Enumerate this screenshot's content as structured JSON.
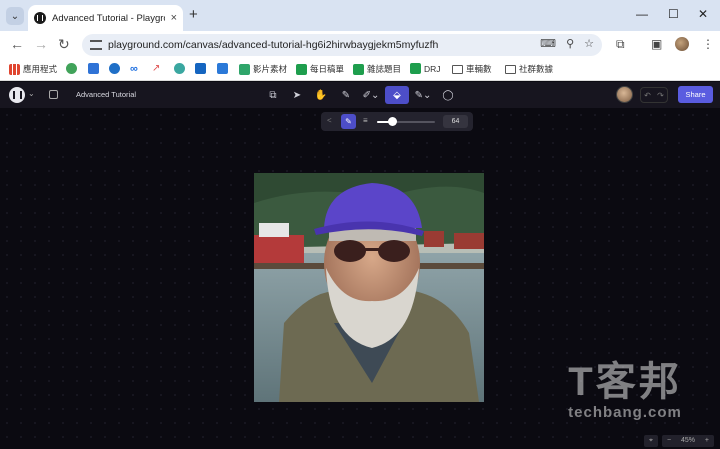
{
  "browser": {
    "tab": {
      "title": "Advanced Tutorial - Playground"
    },
    "url": "playground.com/canvas/advanced-tutorial-hg6i2hirwbaygjekm5myfuzfh",
    "bookmarks": [
      {
        "label": "應用程式",
        "icon": "apps-grid-icon"
      },
      {
        "label": "",
        "icon": "puzzle-icon"
      },
      {
        "label": "",
        "icon": "drive-icon"
      },
      {
        "label": "",
        "icon": "c-icon"
      },
      {
        "label": "",
        "icon": "meta-icon"
      },
      {
        "label": "",
        "icon": "trend-icon"
      },
      {
        "label": "",
        "icon": "circle-icon"
      },
      {
        "label": "",
        "icon": "outlook-icon"
      },
      {
        "label": "",
        "icon": "calendar-icon"
      },
      {
        "label": "影片素材",
        "icon": "green-sheet-icon"
      },
      {
        "label": "每日稿單",
        "icon": "green-plus-icon"
      },
      {
        "label": "雜誌題目",
        "icon": "green-plus-icon"
      },
      {
        "label": "DRJ",
        "icon": "green-plus-icon"
      },
      {
        "label": "車輛數",
        "icon": "folder-icon"
      },
      {
        "label": "社群數據",
        "icon": "folder-icon"
      }
    ]
  },
  "app": {
    "title": "Advanced Tutorial",
    "share_label": "Share",
    "tools": [
      "canvas-icon",
      "pointer-icon",
      "hand-icon",
      "edit-image-icon",
      "draw-icon",
      "paint-bucket-icon",
      "pen-icon",
      "comment-icon"
    ],
    "active_tool": "paint-bucket-icon"
  },
  "brush": {
    "size": "64",
    "slider_fraction": 0.25
  },
  "zoom": {
    "minus": "−",
    "level": "45%",
    "plus": "+"
  },
  "watermark": {
    "big": "T客邦",
    "small": "techbang.com"
  },
  "colors": {
    "accent": "#5a5ce0",
    "canvas_bg": "#0b0a11",
    "app_bar": "#17151f"
  }
}
